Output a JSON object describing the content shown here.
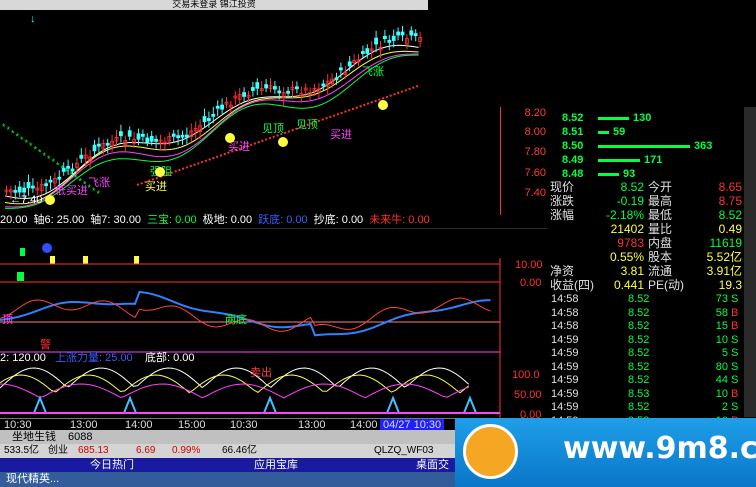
{
  "window": {
    "title": "交易未登录 锦江投资"
  },
  "price_axis": [
    "8.20",
    "8.00",
    "7.80",
    "7.60",
    "7.40"
  ],
  "chart_annotations": {
    "low_marker": "←7.40",
    "buy_low": "低买进",
    "resistance": "强阻",
    "sell_top": "见顶",
    "buy_in": "买进",
    "fly_up": "飞涨"
  },
  "indicator_row": [
    {
      "label": "20.00",
      "color": "#ffffff"
    },
    {
      "label": "轴6: 25.00",
      "color": "#ffffff"
    },
    {
      "label": "轴7: 30.00",
      "color": "#ffffff"
    },
    {
      "label": "三宝: 0.00",
      "color": "#00ff40"
    },
    {
      "label": "极地: 0.00",
      "color": "#ffffff"
    },
    {
      "label": "跃底: 0.00",
      "color": "#3a5cff"
    },
    {
      "label": "抄底: 0.00",
      "color": "#ffffff"
    },
    {
      "label": "未来牛: 0.00",
      "color": "#ff3030"
    }
  ],
  "sub_panel": {
    "scale_top": "10.00",
    "scale_mid": "0.00",
    "mid_label": "两底",
    "mid_label2": "顶",
    "warn": "警",
    "row2": {
      "prefix": "2: 120.00",
      "name": "上涨力量: 25.00",
      "bottom": "底部: 0.00"
    },
    "tag_top": "卖出",
    "scale_a": "100.0",
    "scale_b": "50.00",
    "scale_c": "0.00"
  },
  "order_book": [
    {
      "price": "8.52",
      "vol": "130",
      "bar": 0.34
    },
    {
      "price": "8.51",
      "vol": "59",
      "bar": 0.12
    },
    {
      "price": "8.50",
      "vol": "363",
      "bar": 1.0
    },
    {
      "price": "8.49",
      "vol": "171",
      "bar": 0.46
    },
    {
      "price": "8.48",
      "vol": "93",
      "bar": 0.23
    }
  ],
  "quote": [
    {
      "l": "现价",
      "v": "8.52",
      "vc": "#00ff40",
      "l2": "今开",
      "v2": "8.65",
      "v2c": "#ff3030"
    },
    {
      "l": "涨跌",
      "v": "-0.19",
      "vc": "#00ff40",
      "l2": "最高",
      "v2": "8.75",
      "v2c": "#ff3030"
    },
    {
      "l": "涨幅",
      "v": "-2.18%",
      "vc": "#00ff40",
      "l2": "最低",
      "v2": "8.52",
      "v2c": "#00ff40"
    },
    {
      "l": "",
      "v": "21402",
      "vc": "#ffff40",
      "l2": "量比",
      "v2": "0.49",
      "v2c": "#ffff40"
    },
    {
      "l": "",
      "v": "9783",
      "vc": "#ff3030",
      "l2": "内盘",
      "v2": "11619",
      "v2c": "#00ff40"
    },
    {
      "l": "",
      "v": "0.55%",
      "vc": "#ffff40",
      "l2": "股本",
      "v2": "5.52亿",
      "v2c": "#ffff40"
    },
    {
      "l": "净资",
      "v": "3.81",
      "vc": "#ffff40",
      "l2": "流通",
      "v2": "3.91亿",
      "v2c": "#ffff40"
    },
    {
      "l": "收益(四)",
      "v": "0.441",
      "vc": "#ffff40",
      "l2": "PE(动)",
      "v2": "19.3",
      "v2c": "#ffff40"
    }
  ],
  "ticks": [
    {
      "t": "14:58",
      "p": "8.52",
      "v": "73",
      "bs": "S"
    },
    {
      "t": "14:58",
      "p": "8.52",
      "v": "58",
      "bs": "B"
    },
    {
      "t": "14:58",
      "p": "8.52",
      "v": "15",
      "bs": "B"
    },
    {
      "t": "14:59",
      "p": "8.52",
      "v": "10",
      "bs": "S"
    },
    {
      "t": "14:59",
      "p": "8.52",
      "v": "5",
      "bs": "S"
    },
    {
      "t": "14:59",
      "p": "8.52",
      "v": "80",
      "bs": "S"
    },
    {
      "t": "14:59",
      "p": "8.52",
      "v": "44",
      "bs": "S"
    },
    {
      "t": "14:59",
      "p": "8.53",
      "v": "10",
      "bs": "B"
    },
    {
      "t": "14:59",
      "p": "8.52",
      "v": "2",
      "bs": "S"
    },
    {
      "t": "14:59",
      "p": "8.52",
      "v": "10",
      "bs": "B"
    }
  ],
  "time_axis": [
    "10:30",
    "13:00",
    "14:00",
    "15:00",
    "10:30",
    "13:00",
    "14:00",
    "15:00",
    "04/27 10:30"
  ],
  "status_bar": {
    "left": "坐地生钱",
    "code": "6088",
    "amount": "533.5亿",
    "index_name": "创业",
    "index_val": "685.13",
    "chg": "6.69",
    "pct": "0.99%",
    "amt2": "66.46亿",
    "code2": "QLZQ_WF03"
  },
  "bottom_tabs": {
    "tab1": "今日热门",
    "tab2": "应用宝库",
    "tab3": "桌面交"
  },
  "taskbar": {
    "item": "现代精英..."
  },
  "watermark": {
    "text": "www.9m8.cn"
  }
}
